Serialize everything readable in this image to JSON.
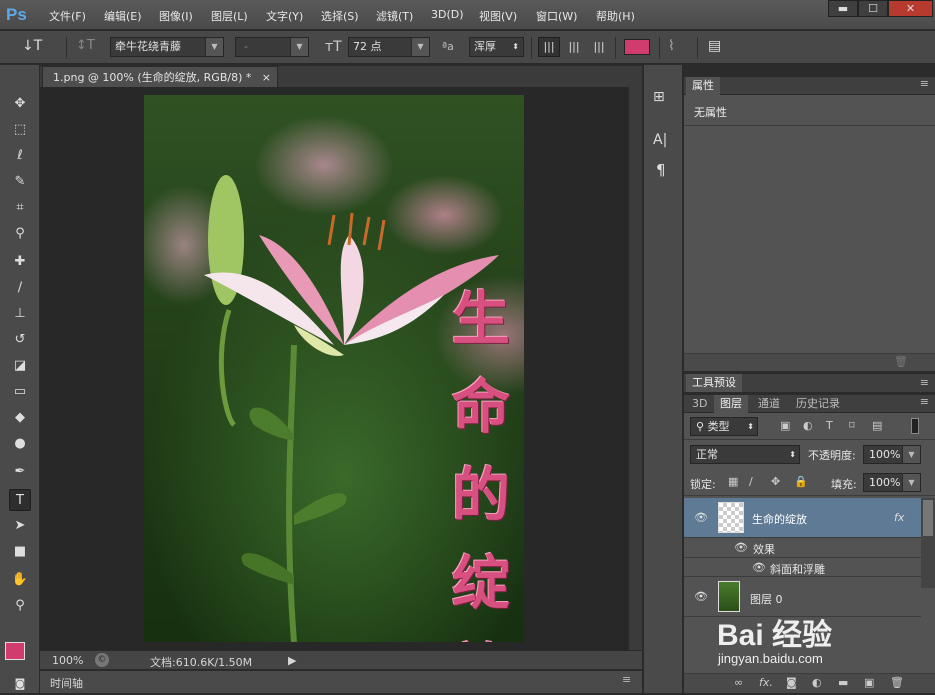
{
  "menu": {
    "logo": "Ps",
    "items": [
      "文件(F)",
      "编辑(E)",
      "图像(I)",
      "图层(L)",
      "文字(Y)",
      "选择(S)",
      "滤镜(T)",
      "3D(D)",
      "视图(V)",
      "窗口(W)",
      "帮助(H)"
    ]
  },
  "window_controls": {
    "minimize": "▬",
    "maximize": "☐",
    "close": "✕"
  },
  "options": {
    "tool_glyph": "↓T",
    "orient_glyph": "↕T",
    "font_family": "牵牛花绕青藤",
    "font_style": "-",
    "font_size": "72 点",
    "aa_label": "ªa",
    "aa_mode": "浑厚",
    "text_color": "#d03c6e",
    "warp_glyph": "⌇",
    "panel_glyph": "▤"
  },
  "document": {
    "tab_title": "1.png @ 100% (生命的绽放, RGB/8) *",
    "tab_close": "×",
    "vertical_text": [
      "生",
      "命",
      "的",
      "绽",
      "放"
    ]
  },
  "status": {
    "zoom": "100%",
    "doc_info": "文档:610.6K/1.50M",
    "arrow": "▶"
  },
  "timeline": {
    "label": "时间轴"
  },
  "properties": {
    "tab": "属性",
    "content": "无属性"
  },
  "presets": {
    "tab": "工具预设"
  },
  "layers_panel": {
    "tabs": [
      "3D",
      "图层",
      "通道",
      "历史记录"
    ],
    "filter_kind": "类型",
    "blend_mode": "正常",
    "opacity_label": "不透明度:",
    "opacity_value": "100%",
    "lock_label": "锁定:",
    "fill_label": "填充:",
    "fill_value": "100%",
    "layers": [
      {
        "name": "生命的绽放",
        "fx": "fx",
        "selected": true
      },
      {
        "name": "效果"
      },
      {
        "name": "斜面和浮雕"
      },
      {
        "name": "图层 0"
      }
    ],
    "footer_icons": [
      "link-icon",
      "fx-icon",
      "mask-icon",
      "adjustment-icon",
      "group-icon",
      "new-layer-icon",
      "trash-icon"
    ]
  },
  "watermark": {
    "brand": "Bai 经验",
    "url": "jingyan.baidu.com"
  }
}
